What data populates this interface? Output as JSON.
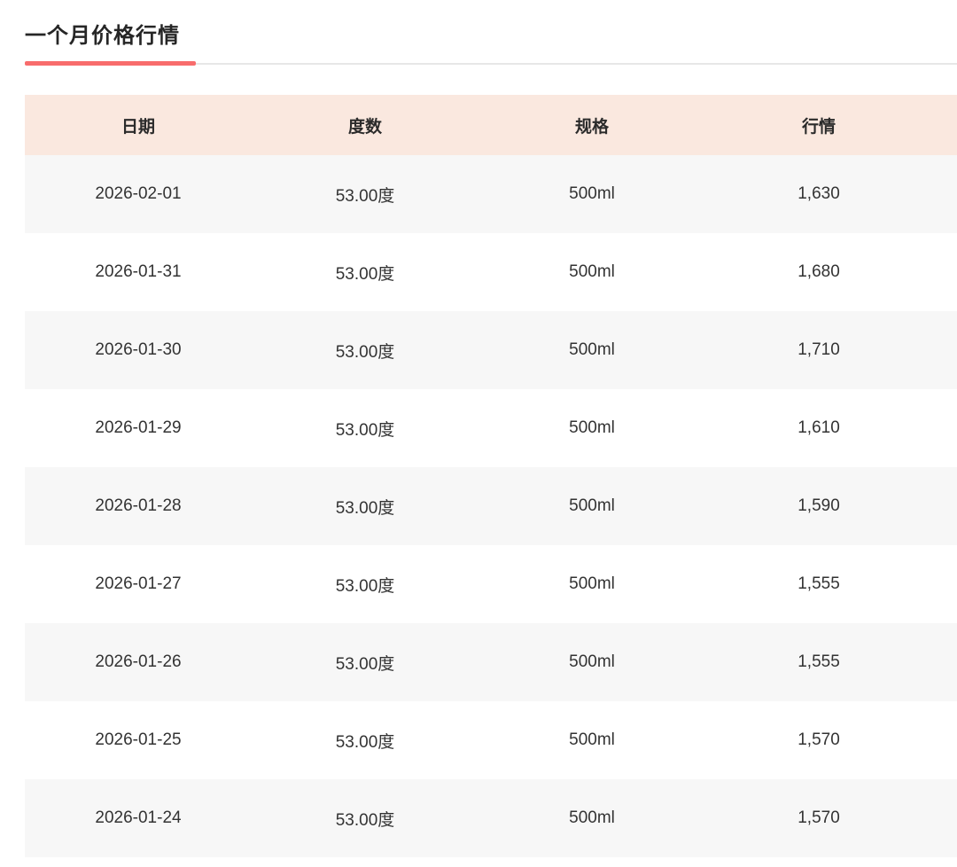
{
  "page": {
    "title": "一个月价格行情"
  },
  "colors": {
    "accent": "#f86c6c",
    "divider": "#e7e7e7",
    "header_bg": "#fae8df",
    "row_alt_bg": "#f7f7f7"
  },
  "table": {
    "columns": [
      {
        "key": "date",
        "label": "日期"
      },
      {
        "key": "degree",
        "label": "度数"
      },
      {
        "key": "spec",
        "label": "规格"
      },
      {
        "key": "price",
        "label": "行情"
      }
    ],
    "rows": [
      {
        "date": "2026-02-01",
        "degree": "53.00度",
        "spec": "500ml",
        "price": "1,630"
      },
      {
        "date": "2026-01-31",
        "degree": "53.00度",
        "spec": "500ml",
        "price": "1,680"
      },
      {
        "date": "2026-01-30",
        "degree": "53.00度",
        "spec": "500ml",
        "price": "1,710"
      },
      {
        "date": "2026-01-29",
        "degree": "53.00度",
        "spec": "500ml",
        "price": "1,610"
      },
      {
        "date": "2026-01-28",
        "degree": "53.00度",
        "spec": "500ml",
        "price": "1,590"
      },
      {
        "date": "2026-01-27",
        "degree": "53.00度",
        "spec": "500ml",
        "price": "1,555"
      },
      {
        "date": "2026-01-26",
        "degree": "53.00度",
        "spec": "500ml",
        "price": "1,555"
      },
      {
        "date": "2026-01-25",
        "degree": "53.00度",
        "spec": "500ml",
        "price": "1,570"
      },
      {
        "date": "2026-01-24",
        "degree": "53.00度",
        "spec": "500ml",
        "price": "1,570"
      }
    ]
  }
}
